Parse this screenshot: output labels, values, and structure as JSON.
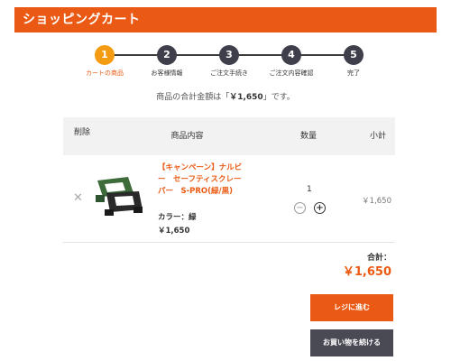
{
  "header": {
    "title": "ショッピングカート"
  },
  "steps": [
    {
      "number": "1",
      "label": "カートの商品",
      "active": true
    },
    {
      "number": "2",
      "label": "お客様情報",
      "active": false
    },
    {
      "number": "3",
      "label": "ご注文手続き",
      "active": false
    },
    {
      "number": "4",
      "label": "ご注文内容確認",
      "active": false
    },
    {
      "number": "5",
      "label": "完了",
      "active": false
    }
  ],
  "total_message": {
    "prefix": "商品の合計金額は「",
    "amount": "￥1,650",
    "suffix": "」です。"
  },
  "table": {
    "headers": {
      "delete": "削除",
      "content": "商品内容",
      "quantity": "数量",
      "subtotal": "小計"
    }
  },
  "item": {
    "delete_icon": "close-icon",
    "name": "【キャンペーン】ナルビー　セーフティスクレーパー　S-PRO(緑/黒)",
    "color": "カラー：緑",
    "price": "￥1,650",
    "quantity": "1",
    "minus_label": "−",
    "plus_label": "+",
    "subtotal": "￥1,650"
  },
  "summary": {
    "label": "合計：",
    "value": "￥1,650"
  },
  "buttons": {
    "checkout": "レジに進む",
    "continue": "お買い物を続ける"
  },
  "colors": {
    "accent": "#eb5a14",
    "step_active": "#f39c12",
    "step_inactive": "#3f3f4b",
    "dark_button": "#4a4a55"
  }
}
